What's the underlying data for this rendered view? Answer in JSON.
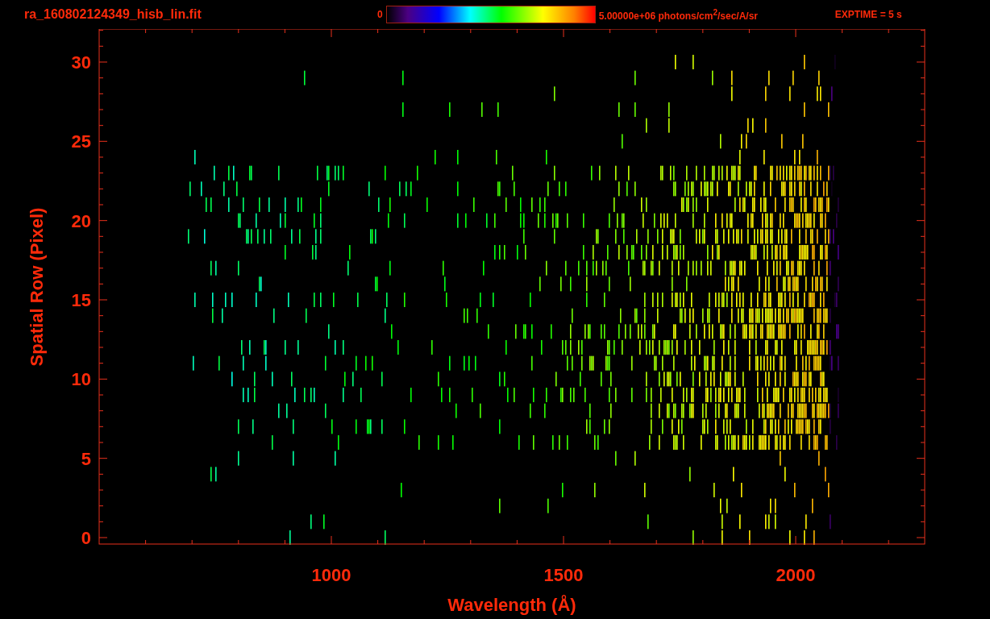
{
  "header": {
    "file_name": "ra_160802124349_hisb_lin.fit",
    "colorbar_min": "0",
    "colorbar_max": "5.00000e+06 photons/cm$^{2}$/sec/A/sr",
    "exposure": "EXPTIME = 5 s"
  },
  "plot": {
    "xlabel": "Wavelength (Å)",
    "ylabel": "Spatial Row (Pixel)",
    "xticks": [
      "1000",
      "1500",
      "2000"
    ],
    "yticks": [
      "30",
      "25",
      "20",
      "15",
      "10",
      "5",
      "0"
    ]
  }
}
